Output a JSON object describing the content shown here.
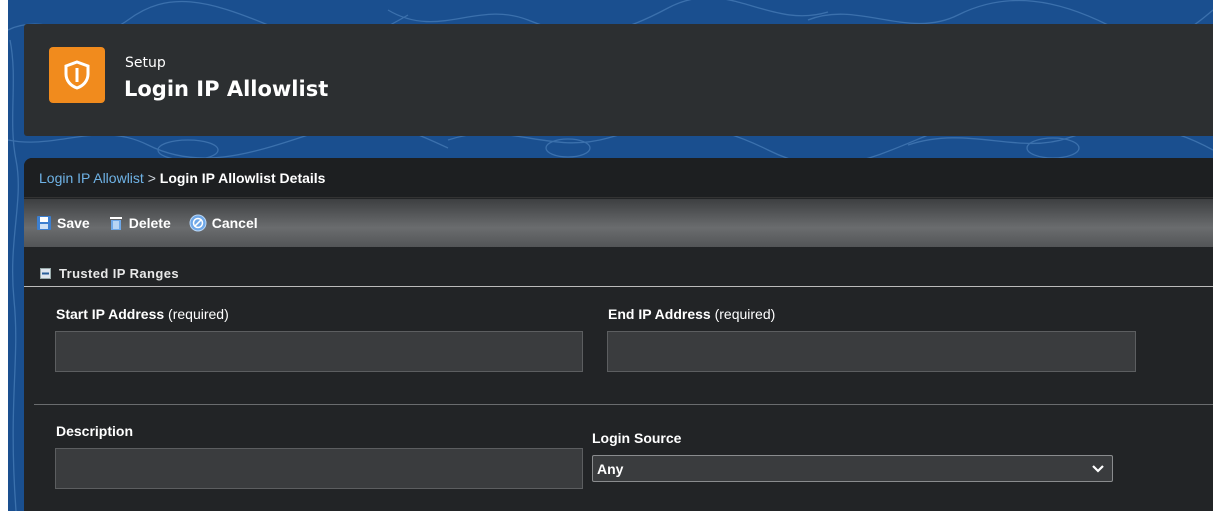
{
  "header": {
    "eyebrow": "Setup",
    "title": "Login IP Allowlist"
  },
  "breadcrumb": {
    "link": "Login IP Allowlist",
    "separator": ">",
    "current": "Login IP Allowlist Details"
  },
  "toolbar": {
    "save_label": "Save",
    "delete_label": "Delete",
    "cancel_label": "Cancel"
  },
  "section": {
    "title": "Trusted IP Ranges"
  },
  "form": {
    "start_ip": {
      "label": "Start IP Address",
      "required": "(required)",
      "value": ""
    },
    "end_ip": {
      "label": "End IP Address",
      "required": "(required)",
      "value": ""
    },
    "description": {
      "label": "Description",
      "value": ""
    },
    "login_source": {
      "label": "Login Source",
      "selected": "Any"
    }
  },
  "colors": {
    "header_bg": "#2c2f31",
    "icon_bg": "#f18b1d",
    "link": "#6fb3e6",
    "panel_bg": "#222426",
    "page_bg": "#1a4f8f"
  },
  "icons": {
    "header": "shield-icon",
    "save": "floppy-disk-icon",
    "delete": "trash-icon",
    "cancel": "cancel-circle-icon",
    "section": "collapse-icon",
    "select": "chevron-down-icon"
  }
}
